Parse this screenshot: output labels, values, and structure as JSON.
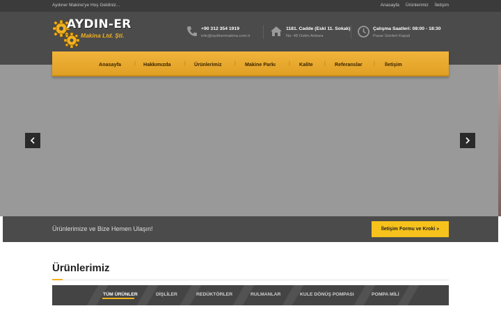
{
  "topbar": {
    "welcome": "Aydıner Makine'ye Hoş Geldiniz...",
    "links": [
      "Anasayfa",
      "Ürünlerimiz",
      "İletişim"
    ]
  },
  "logo": {
    "title": "AYDIN-ER",
    "subtitle": "Makina Ltd. Şti."
  },
  "contact": {
    "phone": {
      "main": "+90 312 354 1919",
      "sub": "info@aydinermakina.com.tr",
      "icon": "phone-icon"
    },
    "address": {
      "main": "1181. Cadde (Eski 11. Sokak)",
      "sub": "No: 48 Ostim Ankara",
      "icon": "home-icon"
    },
    "hours": {
      "main": "Çalışma Saatleri: 08:00 - 18:30",
      "sub": "Pazar Günleri Kapalı",
      "icon": "clock-icon"
    }
  },
  "nav": {
    "items": [
      "Anasayfa",
      "Hakkımızda",
      "Ürünlerimiz",
      "Makine Parkı",
      "Kalite",
      "Referanslar",
      "İletişim"
    ]
  },
  "cta": {
    "text": "Ürünlerimize ve Bize Hemen Ulaşın!",
    "button": "İletişim Formu ve Kroki »"
  },
  "products": {
    "title": "Ürünlerimiz",
    "tabs": [
      "TÜM ÜRÜNLER",
      "DİŞLİLER",
      "REDÜKTÖRLER",
      "RULMANLAR",
      "KULE DÖNÜŞ POMPASI",
      "POMPA MİLİ"
    ],
    "active_tab": "TÜM ÜRÜNLER"
  },
  "colors": {
    "accent": "#f3b11e",
    "header_bg": "#4b4b4b",
    "topbar_bg": "#3b3b3b",
    "cta_button": "#f7c21c"
  }
}
